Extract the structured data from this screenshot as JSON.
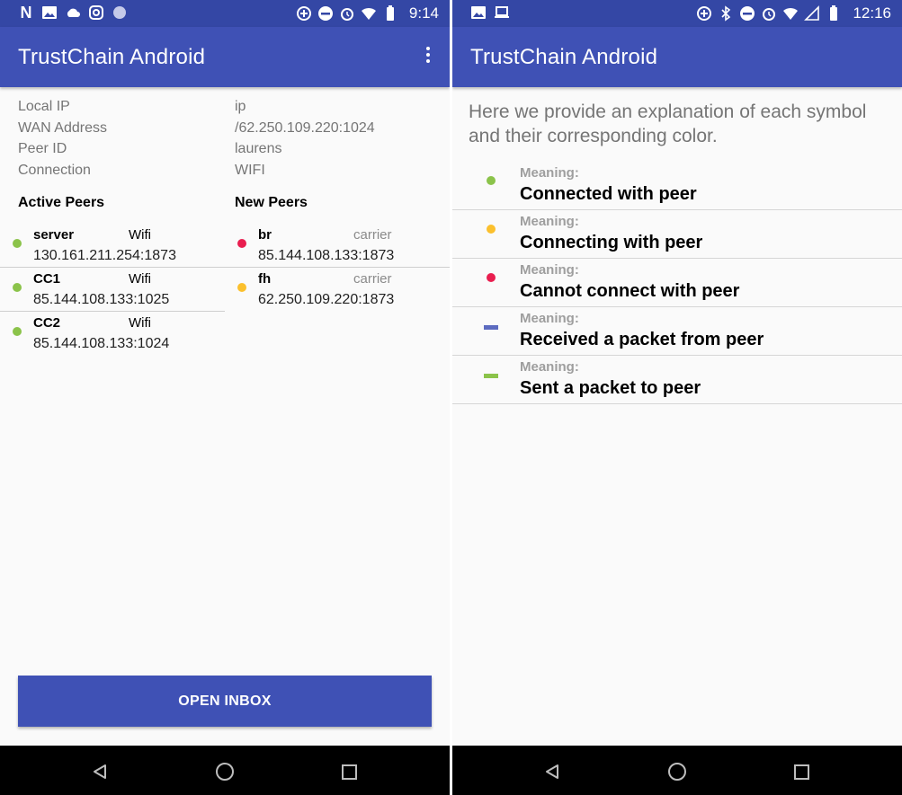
{
  "colors": {
    "primary": "#3f51b5",
    "status_bar": "#3447a5",
    "green": "#8bc34a",
    "amber": "#fbc02d",
    "red": "#e91e4f",
    "blue_bar": "#5c6bc0"
  },
  "left": {
    "status_bar": {
      "icons_left": [
        "netflix-icon",
        "image-icon",
        "cloud-icon",
        "instagram-icon",
        "circle-app-icon"
      ],
      "icons_right": [
        "data-saver-icon",
        "do-not-disturb-icon",
        "alarm-icon",
        "wifi-icon",
        "battery-icon"
      ],
      "time": "9:14",
      "netflix_glyph": "N"
    },
    "app_title": "TrustChain Android",
    "info": [
      {
        "label": "Local IP",
        "value": "ip"
      },
      {
        "label": "WAN Address",
        "value": "/62.250.109.220:1024"
      },
      {
        "label": "Peer ID",
        "value": "laurens"
      },
      {
        "label": "Connection",
        "value": "WIFI"
      }
    ],
    "active_peers_title": "Active Peers",
    "new_peers_title": "New Peers",
    "active_peers": [
      {
        "name": "server",
        "type": "Wifi",
        "address": "130.161.211.254:1873",
        "status": "green"
      },
      {
        "name": "CC1",
        "type": "Wifi",
        "address": "85.144.108.133:1025",
        "status": "green"
      },
      {
        "name": "CC2",
        "type": "Wifi",
        "address": "85.144.108.133:1024",
        "status": "green"
      }
    ],
    "new_peers": [
      {
        "name": "br",
        "type": "carrier",
        "address": "85.144.108.133:1873",
        "status": "red"
      },
      {
        "name": "fh",
        "type": "carrier",
        "address": "62.250.109.220:1873",
        "status": "amber"
      }
    ],
    "open_inbox_label": "OPEN INBOX"
  },
  "right": {
    "status_bar": {
      "icons_left": [
        "image-icon",
        "laptop-icon"
      ],
      "icons_right": [
        "data-saver-icon",
        "bluetooth-icon",
        "do-not-disturb-icon",
        "alarm-icon",
        "wifi-icon",
        "signal-icon",
        "battery-icon"
      ],
      "time": "12:16"
    },
    "app_title": "TrustChain Android",
    "intro": "Here we provide an explanation of each symbol and their corresponding color.",
    "legend": [
      {
        "symbol": "dot",
        "color": "green",
        "label": "Meaning:",
        "text": "Connected with peer"
      },
      {
        "symbol": "dot",
        "color": "amber",
        "label": "Meaning:",
        "text": "Connecting with peer"
      },
      {
        "symbol": "dot",
        "color": "red",
        "label": "Meaning:",
        "text": "Cannot connect with peer"
      },
      {
        "symbol": "bar",
        "color": "blue_bar",
        "label": "Meaning:",
        "text": "Received a packet from peer"
      },
      {
        "symbol": "bar",
        "color": "green",
        "label": "Meaning:",
        "text": "Sent a packet to peer"
      }
    ]
  },
  "nav_bar": {
    "buttons": [
      "back-icon",
      "home-icon",
      "recents-icon"
    ]
  }
}
